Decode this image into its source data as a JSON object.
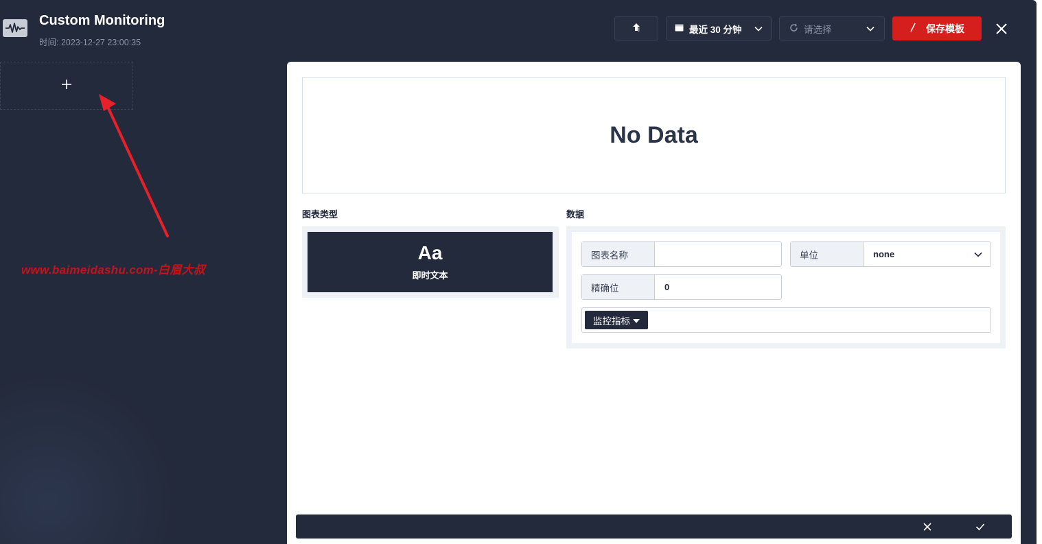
{
  "header": {
    "title": "Custom Monitoring",
    "time": "时间: 2023-12-27 23:00:35"
  },
  "toolbar": {
    "time_range": "最近 30 分钟",
    "refresh_placeholder": "请选择",
    "save_label": "保存模板"
  },
  "sidebar": {
    "add_symbol": "+"
  },
  "watermark": "www.baimeidashu.com-白眉大叔",
  "preview": {
    "empty_text": "No Data"
  },
  "chart_type_section": {
    "label": "图表类型",
    "selected": {
      "icon_text": "Aa",
      "name": "即时文本"
    }
  },
  "data_section": {
    "label": "数据",
    "chart_name_label": "图表名称",
    "chart_name_value": "",
    "unit_label": "单位",
    "unit_value": "none",
    "precision_label": "精确位",
    "precision_value": "0",
    "metric_button": "监控指标"
  },
  "colors": {
    "background": "#232a3b",
    "accent": "#d41f1c",
    "panel": "#ffffff"
  }
}
